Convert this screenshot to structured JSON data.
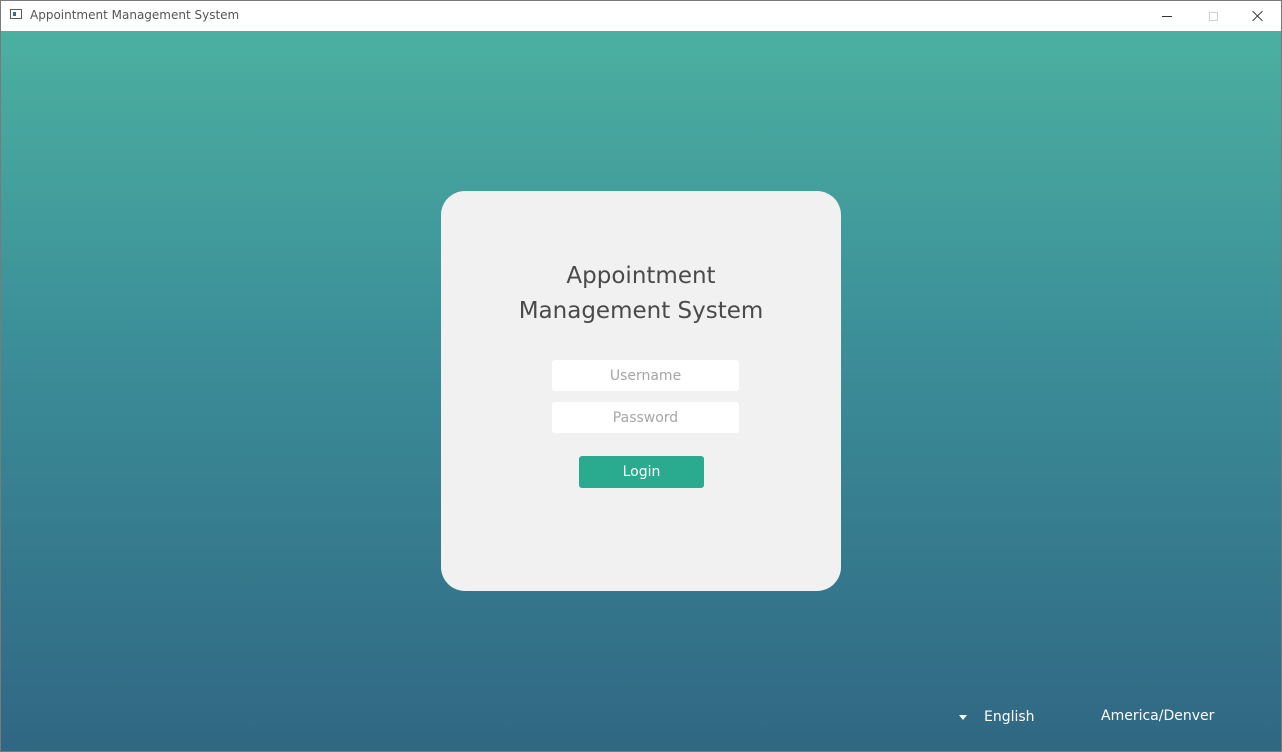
{
  "window": {
    "title": "Appointment Management System",
    "controls": [
      "minimize",
      "maximize",
      "close"
    ]
  },
  "login_card": {
    "title_line1": "Appointment",
    "title_line2": "Management System",
    "username_placeholder": "Username",
    "username_value": "",
    "password_placeholder": "Password",
    "password_value": "",
    "login_label": "Login"
  },
  "footer": {
    "language": "English",
    "zone": "America/Denver"
  },
  "colors": {
    "gradient_top": "#4bb0a0",
    "gradient_bottom": "#306783",
    "card_background": "#f1f1f1",
    "login_button": "#2aab90"
  },
  "icons": {
    "app": "app-icon",
    "minimize": "minimize-icon",
    "maximize": "maximize-icon",
    "close": "close-icon",
    "dropdown": "dropdown-arrow-icon"
  }
}
